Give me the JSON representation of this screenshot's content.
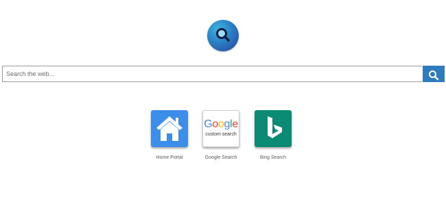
{
  "logo": {
    "icon": "magnifier-logo-icon"
  },
  "search": {
    "placeholder": "Search the web...",
    "value": "",
    "button_icon": "search-icon"
  },
  "shortcuts": [
    {
      "label": "Home Portal",
      "icon": "home-icon"
    },
    {
      "label": "Google Search",
      "icon": "google-custom-search-logo",
      "logo_text": "Google",
      "logo_subtext": "custom search"
    },
    {
      "label": "Bing Search",
      "icon": "bing-logo-icon"
    }
  ],
  "colors": {
    "search_button": "#2f7bbf",
    "home_tile": "#3c8ee8",
    "bing_tile": "#0b8a74"
  }
}
